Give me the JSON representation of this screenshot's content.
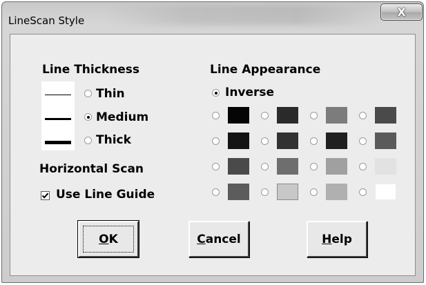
{
  "window": {
    "title": "LineScan Style",
    "close_glyph": "X"
  },
  "line_thickness": {
    "heading": "Line Thickness",
    "options": [
      {
        "label": "Thin",
        "selected": false
      },
      {
        "label": "Medium",
        "selected": true
      },
      {
        "label": "Thick",
        "selected": false
      }
    ]
  },
  "horizontal_scan": {
    "heading": "Horizontal Scan",
    "use_line_guide": {
      "label": "Use Line Guide",
      "checked": true
    }
  },
  "line_appearance": {
    "heading": "Line Appearance",
    "inverse": {
      "label": "Inverse",
      "selected": true
    },
    "color_rows": [
      [
        "#050505",
        "#2a2a2a",
        "#7c7c7c",
        "#4a4a4a"
      ],
      [
        "#141414",
        "#323232",
        "#202020",
        "#5a5a5a"
      ],
      [
        "#4a4a4a",
        "#6e6e6e",
        "#a0a0a0",
        "#e2e2e2"
      ],
      [
        "#5c5c5c",
        "#c8c8c8",
        "#b0b0b0",
        "#ffffff"
      ]
    ]
  },
  "buttons": {
    "ok": {
      "mnemonic": "O",
      "rest": "K"
    },
    "cancel": {
      "mnemonic": "C",
      "rest": "ancel"
    },
    "help": {
      "mnemonic": "H",
      "rest": "elp"
    }
  }
}
